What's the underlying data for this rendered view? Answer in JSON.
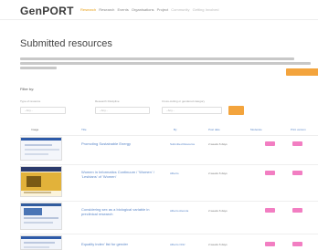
{
  "header": {
    "logo_main": "GenPORT",
    "nav": [
      "Research",
      "Research",
      "Events",
      "Organisations",
      "Project",
      "Community",
      "Getting Involved"
    ]
  },
  "page": {
    "title": "Submitted resources"
  },
  "filter": {
    "title": "Filter by:",
    "fields": [
      {
        "label": "Type of resource",
        "value": "- Any -"
      },
      {
        "label": "Research Discipline",
        "value": "- Any -"
      },
      {
        "label": "Cross-cutting or gendered category",
        "value": "- Any -"
      }
    ]
  },
  "table": {
    "columns": [
      "Image",
      "Title",
      "By",
      "Post date",
      "Moderate",
      "Print version"
    ],
    "rows": [
      {
        "title": "Promoting Sustainable Energy",
        "by": "Submitted Resource",
        "time": "2 weeks 6 days"
      },
      {
        "title": "Women in Informatics Continuum / 'Women' / 'Lesbians' of 'Women'",
        "by": "Alberto",
        "time": "2 weeks 6 days"
      },
      {
        "title": "Considering sex as a biological variable in preclinical research",
        "by": "Alberto Atencia",
        "time": "2 weeks 6 days"
      },
      {
        "title": "Equality index' list for gender",
        "by": "Alberto Ortiz",
        "time": "2 weeks 6 days"
      }
    ]
  }
}
